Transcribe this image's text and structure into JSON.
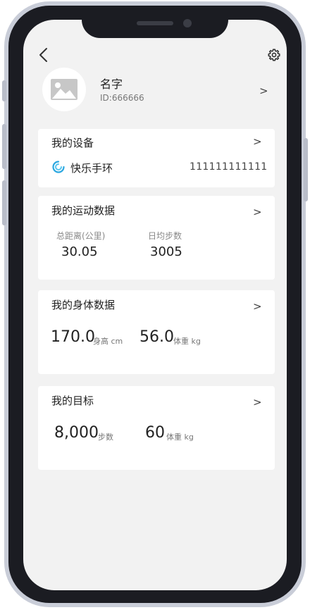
{
  "profile": {
    "name": "名字",
    "id": "ID:666666",
    "arrow": ">"
  },
  "devices": {
    "title": "我的设备",
    "arrow": ">",
    "device_name": "快乐手环",
    "device_id": "111111111111"
  },
  "sport": {
    "title": "我的运动数据",
    "arrow": ">",
    "distance_label": "总距离(公里)",
    "distance_value": "30.05",
    "steps_label": "日均步数",
    "steps_value": "3005"
  },
  "body": {
    "title": "我的身体数据",
    "arrow": ">",
    "height_value": "170.0",
    "height_unit": "身高 cm",
    "weight_value": "56.0",
    "weight_unit": "体重 kg"
  },
  "goal": {
    "title": "我的目标",
    "arrow": ">",
    "steps_value": "8,000",
    "steps_unit": "步数",
    "weight_value": "60",
    "weight_unit": "体重 kg"
  },
  "icons": {
    "back": "back-arrow-icon",
    "settings": "gear-icon",
    "avatar": "image-placeholder-icon",
    "device": "band-icon"
  },
  "colors": {
    "background": "#f2f2f2",
    "card": "#ffffff",
    "device_icon": "#2aa7e0",
    "frame": "#1b1c22"
  }
}
